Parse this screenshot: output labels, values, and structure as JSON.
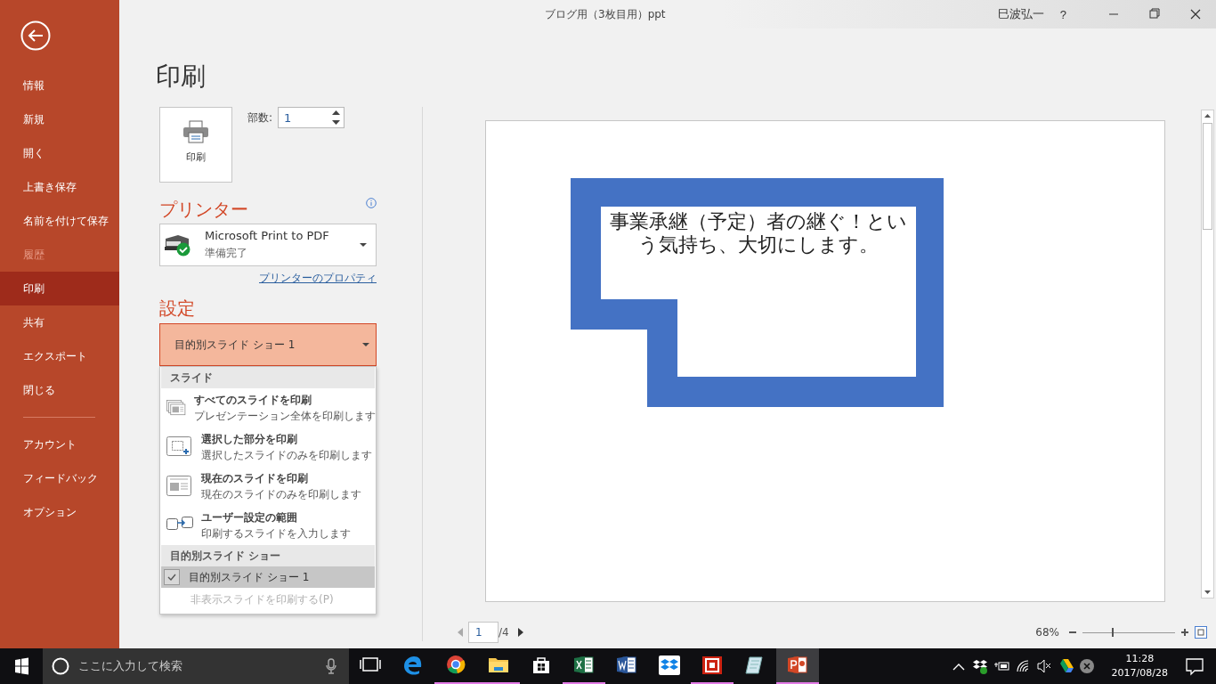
{
  "window": {
    "title": "ブログ用（3枚目用）ppt",
    "user": "巳波弘一",
    "help": "?"
  },
  "sidebar": {
    "items": [
      {
        "label": "情報",
        "selected": false,
        "disabled": false
      },
      {
        "label": "新規",
        "selected": false,
        "disabled": false
      },
      {
        "label": "開く",
        "selected": false,
        "disabled": false
      },
      {
        "label": "上書き保存",
        "selected": false,
        "disabled": false
      },
      {
        "label": "名前を付けて保存",
        "selected": false,
        "disabled": false
      },
      {
        "label": "履歴",
        "selected": false,
        "disabled": true
      },
      {
        "label": "印刷",
        "selected": true,
        "disabled": false
      },
      {
        "label": "共有",
        "selected": false,
        "disabled": false
      },
      {
        "label": "エクスポート",
        "selected": false,
        "disabled": false
      },
      {
        "label": "閉じる",
        "selected": false,
        "disabled": false
      }
    ],
    "footer_items": [
      {
        "label": "アカウント",
        "selected": false,
        "disabled": false
      },
      {
        "label": "フィードバック",
        "selected": false,
        "disabled": false
      },
      {
        "label": "オプション",
        "selected": false,
        "disabled": false
      }
    ]
  },
  "print": {
    "heading": "印刷",
    "button": "印刷",
    "copies_label": "部数:",
    "copies": "1"
  },
  "printer": {
    "heading": "プリンター",
    "name": "Microsoft Print to PDF",
    "status": "準備完了",
    "properties_link": "プリンターのプロパティ"
  },
  "settings": {
    "heading": "設定",
    "selection": "目的別スライド ショー 1",
    "menu": {
      "sections": [
        {
          "title": "スライド",
          "items": [
            {
              "kind": "option",
              "title": "すべてのスライドを印刷",
              "description": "プレゼンテーション全体を印刷します",
              "selected": false
            },
            {
              "kind": "option",
              "title": "選択した部分を印刷",
              "description": "選択したスライドのみを印刷します",
              "selected": false
            },
            {
              "kind": "option",
              "title": "現在のスライドを印刷",
              "description": "現在のスライドのみを印刷します",
              "selected": false
            },
            {
              "kind": "option",
              "title": "ユーザー設定の範囲",
              "description": "印刷するスライドを入力します",
              "selected": false
            }
          ]
        },
        {
          "title": "目的別スライド ショー",
          "items": [
            {
              "kind": "check",
              "label": "目的別スライド ショー 1",
              "checked": true,
              "selected": true
            }
          ]
        }
      ],
      "footer": {
        "label": "非表示スライドを印刷する(P)",
        "disabled": true
      }
    }
  },
  "preview": {
    "slide_text": "事業承継（予定）者の継ぐ！という気持ち、大切にします。",
    "page": "1",
    "page_total": "/4",
    "zoom": "68%",
    "zoom_slider": {
      "level": 0.33
    }
  },
  "taskbar": {
    "search_placeholder": "ここに入力して検索",
    "apps": [
      {
        "running": false,
        "active": false
      },
      {
        "running": false,
        "active": false
      },
      {
        "running": true,
        "active": false
      },
      {
        "running": true,
        "active": false
      },
      {
        "running": false,
        "active": false
      },
      {
        "running": true,
        "active": false
      },
      {
        "running": false,
        "active": false
      },
      {
        "running": false,
        "active": false
      },
      {
        "running": true,
        "active": false
      },
      {
        "running": false,
        "active": false
      },
      {
        "running": true,
        "active": true
      }
    ],
    "time": "11:28",
    "date": "2017/08/28"
  }
}
